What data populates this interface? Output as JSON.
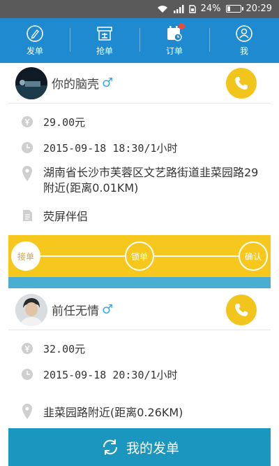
{
  "status_bar": {
    "battery": "24%",
    "time": "20:29",
    "network": "4G",
    "battery_level": 0.24
  },
  "nav": {
    "items": [
      {
        "label": "发单",
        "icon": "pen-icon"
      },
      {
        "label": "抢单",
        "icon": "shop-icon"
      },
      {
        "label": "订单",
        "icon": "calendar-icon",
        "badge": true
      },
      {
        "label": "我",
        "icon": "person-icon"
      }
    ]
  },
  "orders": [
    {
      "name": "你的脑壳",
      "gender": "♂",
      "price": "29.00元",
      "time": "2015-09-18  18:30/1小时",
      "address": "湖南省长沙市芙蓉区文艺路街道韭菜园路29附近(距离0.01KM)",
      "service": "荧屏伴侣"
    },
    {
      "name": "前任无情",
      "gender": "♂",
      "price": "32.00元",
      "time": "2015-09-18 20:30/1小时",
      "address": "韭菜园路附近(距离0.26KM)"
    }
  ],
  "progress": {
    "steps": [
      "接单",
      "锁单",
      "确认"
    ],
    "active_step": 0
  },
  "bottom_button": {
    "label": "我的发单"
  },
  "colors": {
    "primary": "#1f8ad0",
    "accent": "#f2c51d",
    "bottom": "#1b96be"
  }
}
